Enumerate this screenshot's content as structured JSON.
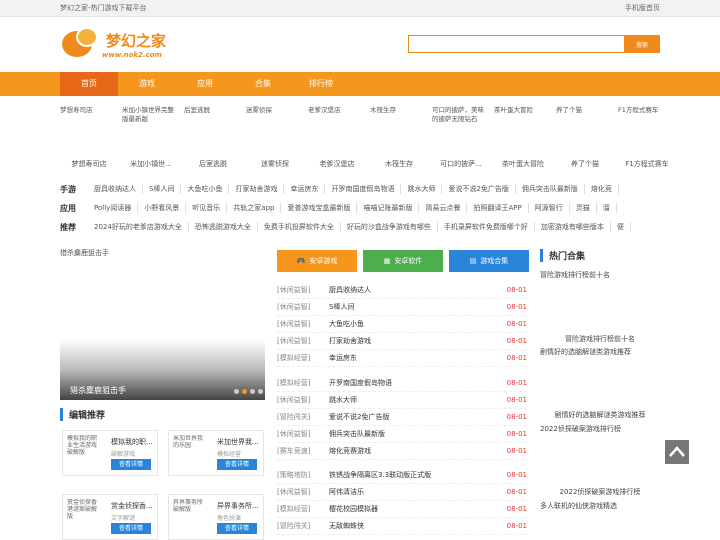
{
  "topbar": {
    "left": "梦幻之家-热门游戏下载平台",
    "right": "手机版首页"
  },
  "logo": {
    "name": "梦幻之家",
    "url": "www.nok2.com"
  },
  "search": {
    "placeholder": "",
    "button": "搜索"
  },
  "nav": [
    "首页",
    "游戏",
    "应用",
    "合集",
    "排行榜"
  ],
  "icon_games": [
    {
      "alt": "梦想寿司店",
      "name": "梦想寿司店"
    },
    {
      "alt": "米加小镇世界完整版最新版",
      "name": "米加小镇世..."
    },
    {
      "alt": "后室逃脱",
      "name": "后室逃脱"
    },
    {
      "alt": "迷雾侦探",
      "name": "迷雾侦探"
    },
    {
      "alt": "老爹汉堡店",
      "name": "老爹汉堡店"
    },
    {
      "alt": "木筏生存",
      "name": "木筏生存"
    },
    {
      "alt": "可口的披萨，美味的披萨无限钻石",
      "name": "可口的披萨..."
    },
    {
      "alt": "茶叶蛋大冒险",
      "name": "茶叶蛋大冒险"
    },
    {
      "alt": "养了个猫",
      "name": "养了个猫"
    },
    {
      "alt": "F1方程式赛车",
      "name": "F1方程式赛车"
    }
  ],
  "rows": [
    {
      "label": "手游",
      "links": [
        "厨具收纳达人",
        "S棒人间",
        "大鱼吃小鱼",
        "打家劫舍游戏",
        "幸运房东",
        "开罗南国度假岛物语",
        "跳水大师",
        "爱说不说2免广告版",
        "佣兵突击队最新版",
        "熔化竞"
      ]
    },
    {
      "label": "应用",
      "links": [
        "Polly阅读器",
        "小野看风景",
        "听见音乐",
        "共轨之家app",
        "爱普游戏宝盒最新版",
        "喵喵记账最新版",
        "简易云点餐",
        "拍照翻译王APP",
        "阿源智行",
        "灵猫",
        "溜"
      ]
    },
    {
      "label": "推荐",
      "links": [
        "2024好玩的老爹店游戏大全",
        "恐怖逃脱游戏大全",
        "免费手机投屏软件大全",
        "好玩的沙盒战争游戏有哪些",
        "手机录屏软件免费版哪个好",
        "加密游戏有哪些版本",
        "便"
      ]
    }
  ],
  "banner": {
    "alt": "猎杀麋鹿狙击手",
    "caption": "猎杀麋鹿狙击手"
  },
  "editor": {
    "title": "编辑推荐",
    "items": [
      {
        "alt": "模拟我的职业生活游戏破解版",
        "title": "模拟我的职...",
        "sub": "破解游戏",
        "btn": "查看详情"
      },
      {
        "alt": "米加世界我的乐园",
        "title": "米加世界我...",
        "sub": "模拟经营",
        "btn": "查看详情"
      },
      {
        "alt": "赏金侦探香港谜案破解版",
        "title": "赏金侦探香...",
        "sub": "文字解谜",
        "btn": "查看详情"
      },
      {
        "alt": "异界事务所破解版",
        "title": "异界事务所...",
        "sub": "角色扮演",
        "btn": "查看详情"
      }
    ]
  },
  "tabs": [
    {
      "label": "安卓游戏",
      "color": "#f5961d",
      "icon": "gamepad-icon"
    },
    {
      "label": "安卓软件",
      "color": "#4cae4c",
      "icon": "apps-icon"
    },
    {
      "label": "游戏合集",
      "color": "#2a85d8",
      "icon": "book-icon"
    }
  ],
  "list1": [
    {
      "cat": "[休闲益智]",
      "name": "厨具收纳达人",
      "date": "08-01"
    },
    {
      "cat": "[休闲益智]",
      "name": "S棒人间",
      "date": "08-01"
    },
    {
      "cat": "[休闲益智]",
      "name": "大鱼吃小鱼",
      "date": "08-01"
    },
    {
      "cat": "[休闲益智]",
      "name": "打家劫舍游戏",
      "date": "08-01"
    },
    {
      "cat": "[模拟经营]",
      "name": "幸运房东",
      "date": "08-01"
    }
  ],
  "list2": [
    {
      "cat": "[模拟经营]",
      "name": "开罗南国度假岛物语",
      "date": "08-01"
    },
    {
      "cat": "[休闲益智]",
      "name": "跳水大师",
      "date": "08-01"
    },
    {
      "cat": "[冒险闯关]",
      "name": "爱说不说2免广告版",
      "date": "08-01"
    },
    {
      "cat": "[休闲益智]",
      "name": "佣兵突击队最新版",
      "date": "08-01"
    },
    {
      "cat": "[赛车竞速]",
      "name": "熔化竞赛游戏",
      "date": "08-01"
    }
  ],
  "list3": [
    {
      "cat": "[策略塔防]",
      "name": "铁锈战争隔离区3.3联动版正式版",
      "date": "08-01"
    },
    {
      "cat": "[休闲益智]",
      "name": "阿伟清洁乐",
      "date": "08-01"
    },
    {
      "cat": "[模拟经营]",
      "name": "樱花校园模拟器",
      "date": "08-01"
    },
    {
      "cat": "[冒险闯关]",
      "name": "无敌蜘蛛侠",
      "date": "08-01"
    }
  ],
  "hot": {
    "title": "热门合集",
    "items": [
      {
        "alt": "冒险游戏排行榜前十名",
        "caption": "冒险游戏排行榜前十名"
      },
      {
        "alt": "剧情好的选脑解谜类游戏推荐",
        "caption": "剧情好的选脑解谜类游戏推荐"
      },
      {
        "alt": "2022侦探破案游戏排行榜",
        "caption": "2022侦探破案游戏排行榜"
      },
      {
        "alt": "多人联机的仙侠游戏精选",
        "caption": ""
      }
    ]
  }
}
